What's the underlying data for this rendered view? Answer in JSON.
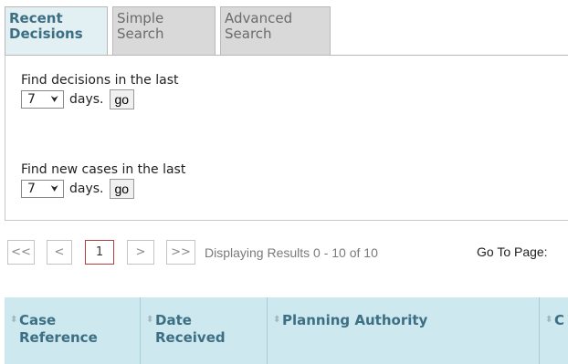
{
  "tabs": [
    {
      "line1": "Recent",
      "line2": "Decisions"
    },
    {
      "line1": "Simple",
      "line2": "Search"
    },
    {
      "line1": "Advanced",
      "line2": "Search"
    }
  ],
  "finders": [
    {
      "label": "Find decisions in the last",
      "selected": "7",
      "suffix": "days.",
      "button": "go"
    },
    {
      "label": "Find new cases in the last",
      "selected": "7",
      "suffix": "days.",
      "button": "go"
    }
  ],
  "pager": {
    "first": "<<",
    "prev": "<",
    "current_page": "1",
    "next": ">",
    "last": ">>",
    "displaying": "Displaying Results 0 - 10 of 10",
    "goto_label": "Go To Page:"
  },
  "table": {
    "sort_icon": "⬍",
    "columns": [
      {
        "line1": "Case",
        "line2": "Reference"
      },
      {
        "line1": "Date",
        "line2": "Received"
      },
      {
        "line1": "Planning Authority",
        "line2": ""
      },
      {
        "line1": "C",
        "line2": ""
      }
    ]
  }
}
